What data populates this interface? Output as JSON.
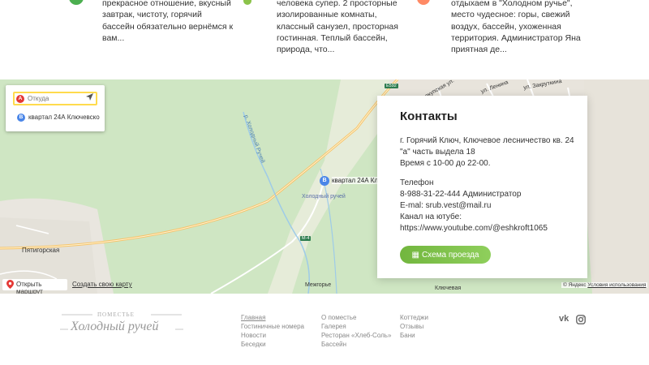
{
  "reviews": [
    {
      "lines": [
        "прекрасное отношение, вкусный",
        "завтрак, чистоту, горячий",
        "бассейн обязательно вернёмся к",
        "вам..."
      ],
      "color": "#4caf50"
    },
    {
      "lines": [
        "человека супер. 2 просторные",
        "изолированные комнаты,",
        "классный санузел, просторная",
        "гостинная. Теплый бассейн,",
        "природа, что..."
      ],
      "color": "#8bc34a"
    },
    {
      "lines": [
        "отдыхаем в \"Холодном ручье\",",
        "место чудесное: горы, свежий",
        "воздух, бассейн, ухоженная",
        "территория. Администратор Яна",
        "приятная де..."
      ],
      "color": "#ff8a65"
    }
  ],
  "map": {
    "route": {
      "from_placeholder": "Откуда",
      "a_badge": "A",
      "b_badge": "B",
      "to_text": "квартал 24А Ключевско"
    },
    "marker": {
      "badge": "B",
      "label": "квартал 24А Кл"
    },
    "labels": {
      "kholodny_ruchey": "Холодный ручей",
      "pyatigorskaya": "Пятигорская",
      "mezhgorye": "Межгорье",
      "klyuchevaya": "Ключевая",
      "river": "р. Холодный Ручей",
      "street1": "Псекупская ул.",
      "street2": "ул. Ленина",
      "street3": "ул. Закруткина",
      "road_e592": "E592",
      "road_m4": "М-4"
    },
    "open_route": "Открыть маршрут",
    "create_map": "Создать свою карту",
    "copyright": "© Яндекс",
    "terms": "Условия использования"
  },
  "contacts": {
    "title": "Контакты",
    "address_line1": "г. Горячий Ключ, Ключевое лесничество кв. 24",
    "address_line2": "\"а\" часть выдела 18",
    "hours": "Время с 10-00 до 22-00.",
    "phone_label": "Телефон",
    "phone": "8-988-31-22-444 Администратор",
    "email": "E-mal: srub.vest@mail.ru",
    "youtube_label": "Канал на ютубе:",
    "youtube_url": "https://www.youtube.com/@eshkroft1065",
    "scheme_button": "Схема проезда"
  },
  "footer": {
    "logo_top": "ПОМЕСТЬЕ",
    "logo_main": "Холодный ручей",
    "col1": [
      "Главная",
      "Гостиничные номера",
      "Новости",
      "Беседки"
    ],
    "col2": [
      "О поместье",
      "Галерея",
      "Ресторан «Хлеб-Соль»",
      "Бассейн"
    ],
    "col3": [
      "Коттеджи",
      "Отзывы",
      "Бани"
    ],
    "social": [
      "vk-icon",
      "instagram-icon"
    ]
  }
}
